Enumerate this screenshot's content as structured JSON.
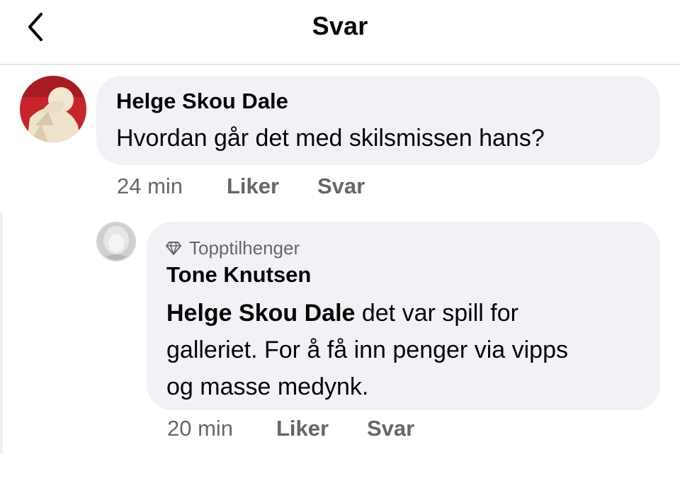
{
  "header": {
    "title": "Svar",
    "back_icon": "chevron-left-icon"
  },
  "comment": {
    "author": "Helge Skou Dale",
    "text": "Hvordan går det med skilsmissen hans?",
    "time": "24 min",
    "like_label": "Liker",
    "reply_label": "Svar"
  },
  "reply": {
    "badge_icon": "diamond-icon",
    "badge": "Topptilhenger",
    "author": "Tone Knutsen",
    "mention": "Helge Skou Dale",
    "text_line1": " det var spill for",
    "text_line2": "galleriet. For å få inn penger via vipps",
    "text_line3": "og masse medynk.",
    "time": "20 min",
    "like_label": "Liker",
    "reply_label": "Svar"
  },
  "colors": {
    "bubble_bg": "#f0f2f5",
    "secondary_text": "#65676b",
    "divider": "#e4e6eb"
  }
}
